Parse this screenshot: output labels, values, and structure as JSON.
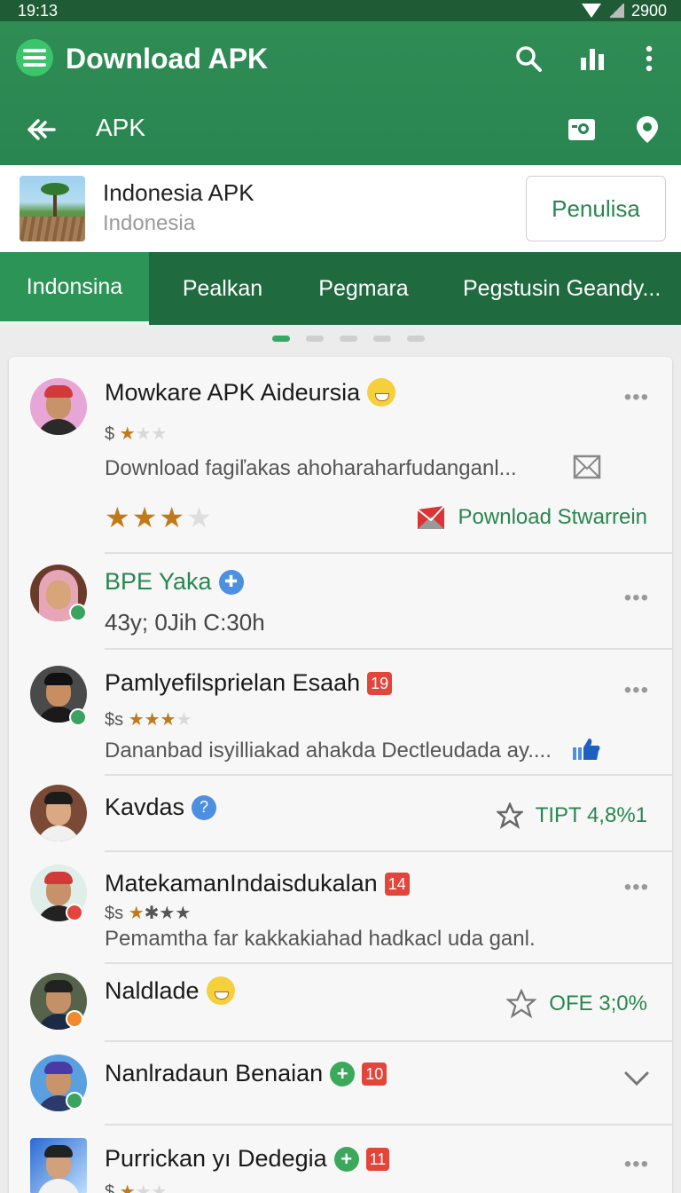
{
  "status": {
    "time": "19:13",
    "battery": "2900"
  },
  "appbar": {
    "title": "Download APK",
    "subtitle": "APK"
  },
  "header": {
    "title": "Indonesia APK",
    "subtitle": "Indonesia",
    "button": "Penulisa"
  },
  "tabs": [
    "Indonsina",
    "Pealkan",
    "Pegmara",
    "Pegstusin Geandy..."
  ],
  "items": [
    {
      "name": "Mowkare APK Aideursia",
      "prefix": "$",
      "desc": "Download fagiľakas ahoharaharfudanganl...",
      "rating": 3,
      "action": "Pownload Stwarrein"
    },
    {
      "name": "BPE Yaka",
      "meta": "43y; 0Jih C:30h"
    },
    {
      "name": "Pamlyefilsprielan Esaah",
      "badge": "19",
      "prefix": "$s",
      "desc": "Dananbad isyilliakad ahakda Dectleudada ay...."
    },
    {
      "name": "Kavdas",
      "action": "TIPT 4,8%1"
    },
    {
      "name": "MatekamanIndaisdukalan",
      "badge": "14",
      "prefix": "$s",
      "desc": "Pemamtha far kakkakiahad hadkacl uda ganl."
    },
    {
      "name": "Naldlade",
      "action": "OFE 3;0%"
    },
    {
      "name": "Nanlradaun Benaian",
      "badge": "10"
    },
    {
      "name": "Purrickan yı Dedegia",
      "badge": "11",
      "prefix": "$"
    }
  ],
  "colors": {
    "primary": "#2a8650",
    "dark": "#1f6a3e",
    "accent": "#37a864"
  }
}
